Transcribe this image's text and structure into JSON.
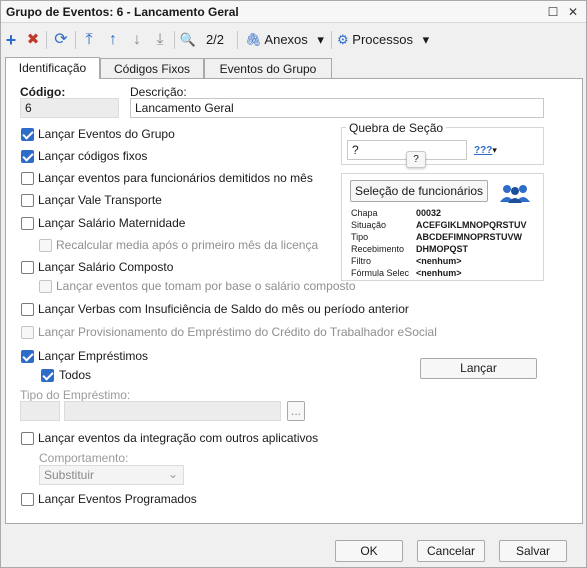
{
  "window": {
    "title": "Grupo de Eventos: 6 - Lancamento Geral"
  },
  "titlebar": {
    "restore_glyph": "☐",
    "close_glyph": "✕"
  },
  "toolbar": {
    "add_icon": "+",
    "delete_icon": "✖",
    "refresh_icon": "⟳",
    "first_icon": "⤒",
    "prev_icon": "↑",
    "next_icon": "↓",
    "last_icon": "⤓",
    "search_icon": "🔍",
    "page_indicator": "2/2",
    "anexos_label": "Anexos",
    "processos_label": "Processos",
    "dropdown_glyph": "▾"
  },
  "tabs": [
    {
      "label": "Identificação",
      "active": true
    },
    {
      "label": "Códigos Fixos",
      "active": false
    },
    {
      "label": "Eventos do Grupo",
      "active": false
    }
  ],
  "form": {
    "codigo_label": "Código:",
    "codigo_value": "6",
    "descricao_label": "Descrição:",
    "descricao_value": "Lancamento Geral"
  },
  "checkboxes": {
    "lancar_eventos_grupo": {
      "label": "Lançar Eventos do Grupo",
      "checked": true
    },
    "lancar_codigos_fixos": {
      "label": "Lançar códigos fixos",
      "checked": true
    },
    "lancar_demitidos": {
      "label": "Lançar eventos para funcionários demitidos no mês",
      "checked": false
    },
    "lancar_vale_transporte": {
      "label": "Lançar Vale Transporte",
      "checked": false
    },
    "lancar_salario_maternidade": {
      "label": "Lançar Salário Maternidade",
      "checked": false
    },
    "recalcular_media": {
      "label": "Recalcular media após o primeiro mês da licença",
      "checked": false
    },
    "lancar_salario_composto": {
      "label": "Lançar Salário Composto",
      "checked": false
    },
    "lancar_eventos_base": {
      "label": "Lançar eventos que tomam por base o salário composto",
      "checked": false
    },
    "lancar_verbas_insuficiencia": {
      "label": "Lançar Verbas com Insuficiência de Saldo do mês ou período anterior",
      "checked": false
    },
    "lancar_provisionamento": {
      "label": "Lançar Provisionamento do Empréstimo do Crédito do Trabalhador eSocial",
      "checked": false
    },
    "lancar_emprestimos": {
      "label": "Lançar Empréstimos",
      "checked": true
    },
    "todos": {
      "label": "Todos",
      "checked": true
    },
    "lancar_integracao": {
      "label": "Lançar eventos da integração com outros aplicativos",
      "checked": false
    },
    "lancar_programados": {
      "label": "Lançar Eventos Programados",
      "checked": false
    }
  },
  "quebra_secao": {
    "title": "Quebra de Seção",
    "value": "?",
    "tooltip": "?",
    "lookup_label": "???"
  },
  "selecao": {
    "button_label": "Seleção de funcionários",
    "rows": [
      {
        "key": "Chapa",
        "value": "00032"
      },
      {
        "key": "Situação",
        "value": "ACEFGIKLMNOPQRSTUV"
      },
      {
        "key": "Tipo",
        "value": "ABCDEFIMNOPRSTUVW"
      },
      {
        "key": "Recebimento",
        "value": "DHMOPQST"
      },
      {
        "key": "Filtro",
        "value": "<nenhum>"
      },
      {
        "key": "Fórmula Selec",
        "value": "<nenhum>"
      }
    ]
  },
  "lancar_button": "Lançar",
  "tipo_emprestimo": {
    "label": "Tipo do Empréstimo:",
    "browse": "..."
  },
  "comportamento": {
    "label": "Comportamento:",
    "value": "Substituir"
  },
  "footer": {
    "ok": "OK",
    "cancelar": "Cancelar",
    "salvar": "Salvar"
  }
}
